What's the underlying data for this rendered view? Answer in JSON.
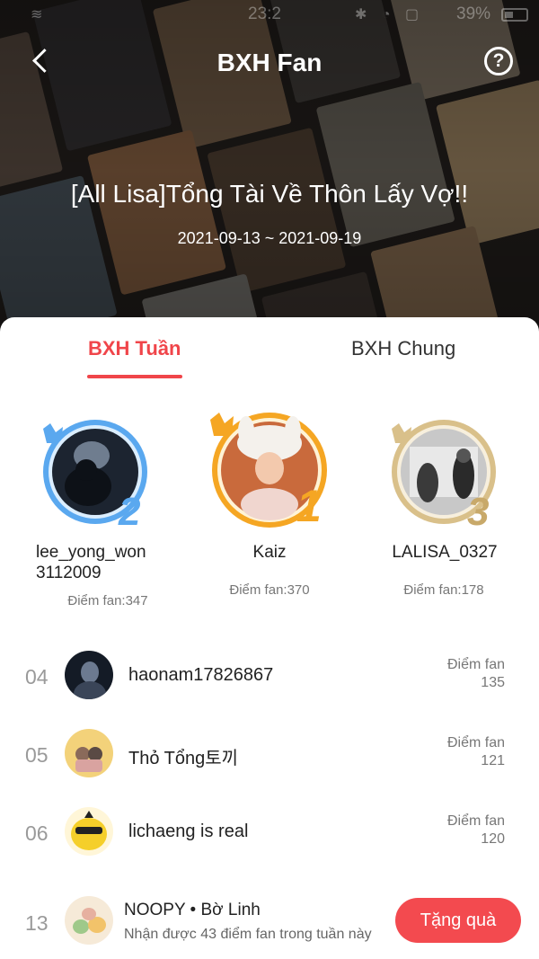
{
  "status_bar": {
    "time": "23:2",
    "battery_percent": "39%"
  },
  "header": {
    "title": "BXH Fan",
    "back_icon": "chevron-left-icon",
    "help_icon": "question-circle-icon",
    "help_glyph": "?"
  },
  "book": {
    "title": "[All Lisa]Tổng Tài Về Thôn Lấy Vợ!!",
    "date_range": "2021-09-13 ~ 2021-09-19"
  },
  "tabs": [
    {
      "label": "BXH Tuần",
      "active": true
    },
    {
      "label": "BXH Chung",
      "active": false
    }
  ],
  "podium": [
    {
      "rank": "2",
      "name_line1": "lee_yong_won",
      "name_line2": "3112009",
      "score": "Điểm fan:347",
      "ring_color": "#5aa8ef"
    },
    {
      "rank": "1",
      "name_line1": "Kaiz",
      "name_line2": "",
      "score": "Điểm fan:370",
      "ring_color": "#f5a623"
    },
    {
      "rank": "3",
      "name_line1": "LALISA_0327",
      "name_line2": "",
      "score": "Điểm fan:178",
      "ring_color": "#d9c08a"
    }
  ],
  "ranking": [
    {
      "rank": "04",
      "name": "haonam17826867",
      "label": "Điểm fan",
      "value": "135"
    },
    {
      "rank": "05",
      "name": "Thỏ Tổng토끼",
      "label": "Điểm fan",
      "value": "121"
    },
    {
      "rank": "06",
      "name": "lichaeng is real",
      "label": "Điểm fan",
      "value": "120"
    }
  ],
  "me": {
    "rank": "13",
    "name": "NOOPY • Bờ Linh",
    "subtitle": "Nhận được 43 điểm fan trong tuần này",
    "button": "Tặng quà"
  },
  "colors": {
    "accent": "#f0454a",
    "button": "#f34a4f"
  }
}
